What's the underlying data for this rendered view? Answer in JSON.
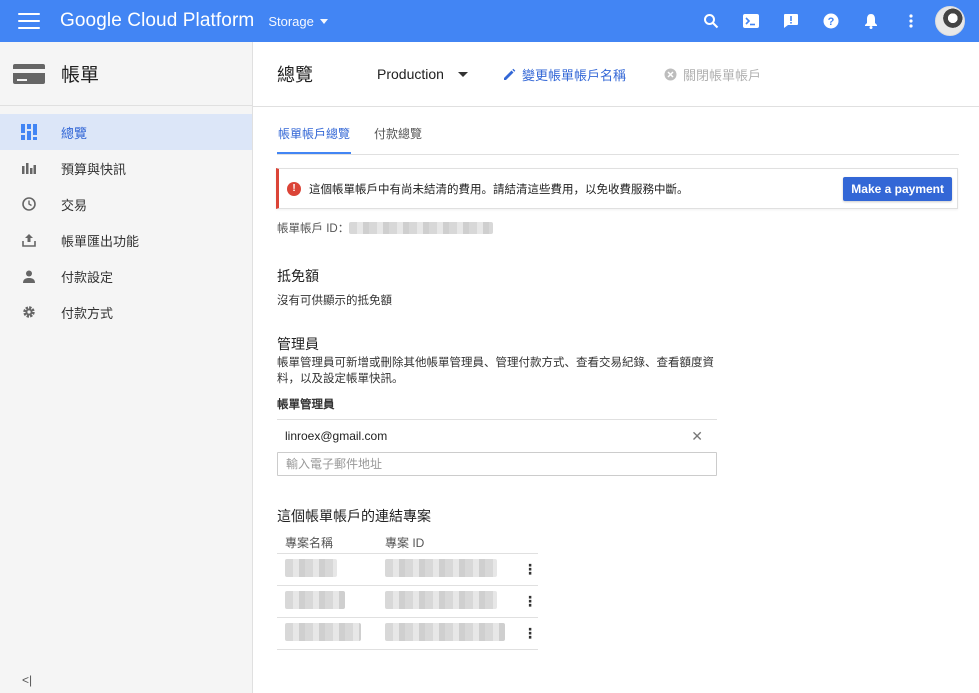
{
  "topbar": {
    "brand": "Google Cloud Platform",
    "project_picker": "Storage"
  },
  "sidebar": {
    "title": "帳單",
    "items": [
      {
        "label": "總覽",
        "icon": "dashboard-icon",
        "active": true
      },
      {
        "label": "預算與快訊",
        "icon": "budget-chart-icon",
        "active": false
      },
      {
        "label": "交易",
        "icon": "clock-icon",
        "active": false
      },
      {
        "label": "帳單匯出功能",
        "icon": "export-upload-icon",
        "active": false
      },
      {
        "label": "付款設定",
        "icon": "person-icon",
        "active": false
      },
      {
        "label": "付款方式",
        "icon": "gear-icon",
        "active": false
      }
    ],
    "collapse_label": "<|"
  },
  "header": {
    "title": "總覽",
    "account_name": "Production",
    "rename_label": "變更帳單帳戶名稱",
    "close_label": "關閉帳單帳戶"
  },
  "tabs": [
    {
      "label": "帳單帳戶總覽",
      "active": true
    },
    {
      "label": "付款總覽",
      "active": false
    }
  ],
  "alert": {
    "message": "這個帳單帳戶中有尚未結清的費用。請結清這些費用，以免收費服務中斷。",
    "button_label": "Make a payment"
  },
  "account_id": {
    "label": "帳單帳戶 ID："
  },
  "credits": {
    "title": "抵免額",
    "empty_text": "沒有可供顯示的抵免額"
  },
  "admins": {
    "title": "管理員",
    "description": "帳單管理員可新增或刪除其他帳單管理員、管理付款方式、查看交易紀錄、查看額度資料，以及設定帳單快訊。",
    "list_label": "帳單管理員",
    "emails": [
      "linroex@gmail.com"
    ],
    "input_placeholder": "輸入電子郵件地址"
  },
  "projects": {
    "title": "這個帳單帳戶的連結專案",
    "columns": [
      "專案名稱",
      "專案 ID"
    ]
  },
  "colors": {
    "topbar": "#4285f4",
    "accent": "#3367d6",
    "alert_red": "#db4437"
  }
}
